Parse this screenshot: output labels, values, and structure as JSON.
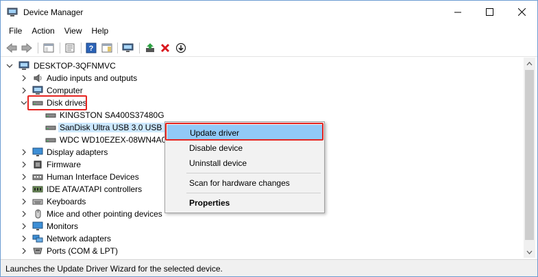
{
  "window": {
    "title": "Device Manager"
  },
  "menu": [
    "File",
    "Action",
    "View",
    "Help"
  ],
  "toolbar_icons": [
    "back-arrow-icon",
    "forward-arrow-icon",
    "show-hide-tree-icon",
    "properties-icon",
    "help-icon",
    "action-pane-icon",
    "scan-hardware-icon",
    "update-driver-icon",
    "uninstall-red-x-icon",
    "disable-device-down-arrow-icon"
  ],
  "tree": {
    "root": "DESKTOP-3QFNMVC",
    "items": [
      {
        "label": "Audio inputs and outputs",
        "icon": "speaker-icon",
        "expanded": false
      },
      {
        "label": "Computer",
        "icon": "computer-icon",
        "expanded": false
      },
      {
        "label": "Disk drives",
        "icon": "disk-drive-icon",
        "expanded": true
      },
      {
        "label": "KINGSTON SA400S37480G",
        "icon": "disk-drive-icon",
        "child": true
      },
      {
        "label": "SanDisk Ultra USB 3.0 USB Device",
        "icon": "disk-drive-icon",
        "child": true,
        "selected": true
      },
      {
        "label": "WDC WD10EZEX-08WN4A0",
        "icon": "disk-drive-icon",
        "child": true
      },
      {
        "label": "Display adapters",
        "icon": "monitor-icon",
        "expanded": false
      },
      {
        "label": "Firmware",
        "icon": "chip-icon",
        "expanded": false
      },
      {
        "label": "Human Interface Devices",
        "icon": "hid-icon",
        "expanded": false
      },
      {
        "label": "IDE ATA/ATAPI controllers",
        "icon": "ide-controller-icon",
        "expanded": false
      },
      {
        "label": "Keyboards",
        "icon": "keyboard-icon",
        "expanded": false
      },
      {
        "label": "Mice and other pointing devices",
        "icon": "mouse-icon",
        "expanded": false
      },
      {
        "label": "Monitors",
        "icon": "monitor-icon",
        "expanded": false
      },
      {
        "label": "Network adapters",
        "icon": "network-icon",
        "expanded": false
      },
      {
        "label": "Ports (COM & LPT)",
        "icon": "port-icon",
        "expanded": false
      }
    ]
  },
  "context_menu": {
    "items": [
      "Update driver",
      "Disable device",
      "Uninstall device",
      "Scan for hardware changes",
      "Properties"
    ]
  },
  "status": {
    "text": "Launches the Update Driver Wizard for the selected device."
  },
  "colors": {
    "highlight": "#91c9f7",
    "selection": "#cce8ff",
    "annotation_red": "#e52420"
  }
}
